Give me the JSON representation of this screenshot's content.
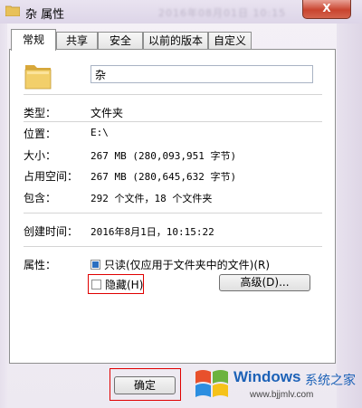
{
  "window": {
    "title": "杂 属性",
    "close_label": "X",
    "blurred_bg_text": "2016年08月01日 10:15"
  },
  "tabs": [
    {
      "label": "常规",
      "active": true
    },
    {
      "label": "共享",
      "active": false
    },
    {
      "label": "安全",
      "active": false
    },
    {
      "label": "以前的版本",
      "active": false
    },
    {
      "label": "自定义",
      "active": false
    }
  ],
  "general": {
    "name_value": "杂",
    "fields": {
      "type_label": "类型：",
      "type_value": "文件夹",
      "location_label": "位置：",
      "location_value": "E:\\",
      "size_label": "大小：",
      "size_value": "267 MB (280,093,951 字节)",
      "disk_size_label": "占用空间：",
      "disk_size_value": "267 MB (280,645,632 字节)",
      "contains_label": "包含：",
      "contains_value": "292 个文件，18 个文件夹",
      "created_label": "创建时间：",
      "created_value": "2016年8月1日，10:15:22",
      "attributes_label": "属性："
    },
    "readonly_label": "只读(仅应用于文件夹中的文件)(R)",
    "hidden_label": "隐藏(H)",
    "advanced_label": "高级(D)..."
  },
  "footer": {
    "ok_label": "确定"
  },
  "watermark": {
    "brand": "Windows",
    "cn": "系统之家",
    "url": "www.bjjmlv.com"
  },
  "colors": {
    "accent": "#1d62b7",
    "highlight": "#e00000"
  }
}
